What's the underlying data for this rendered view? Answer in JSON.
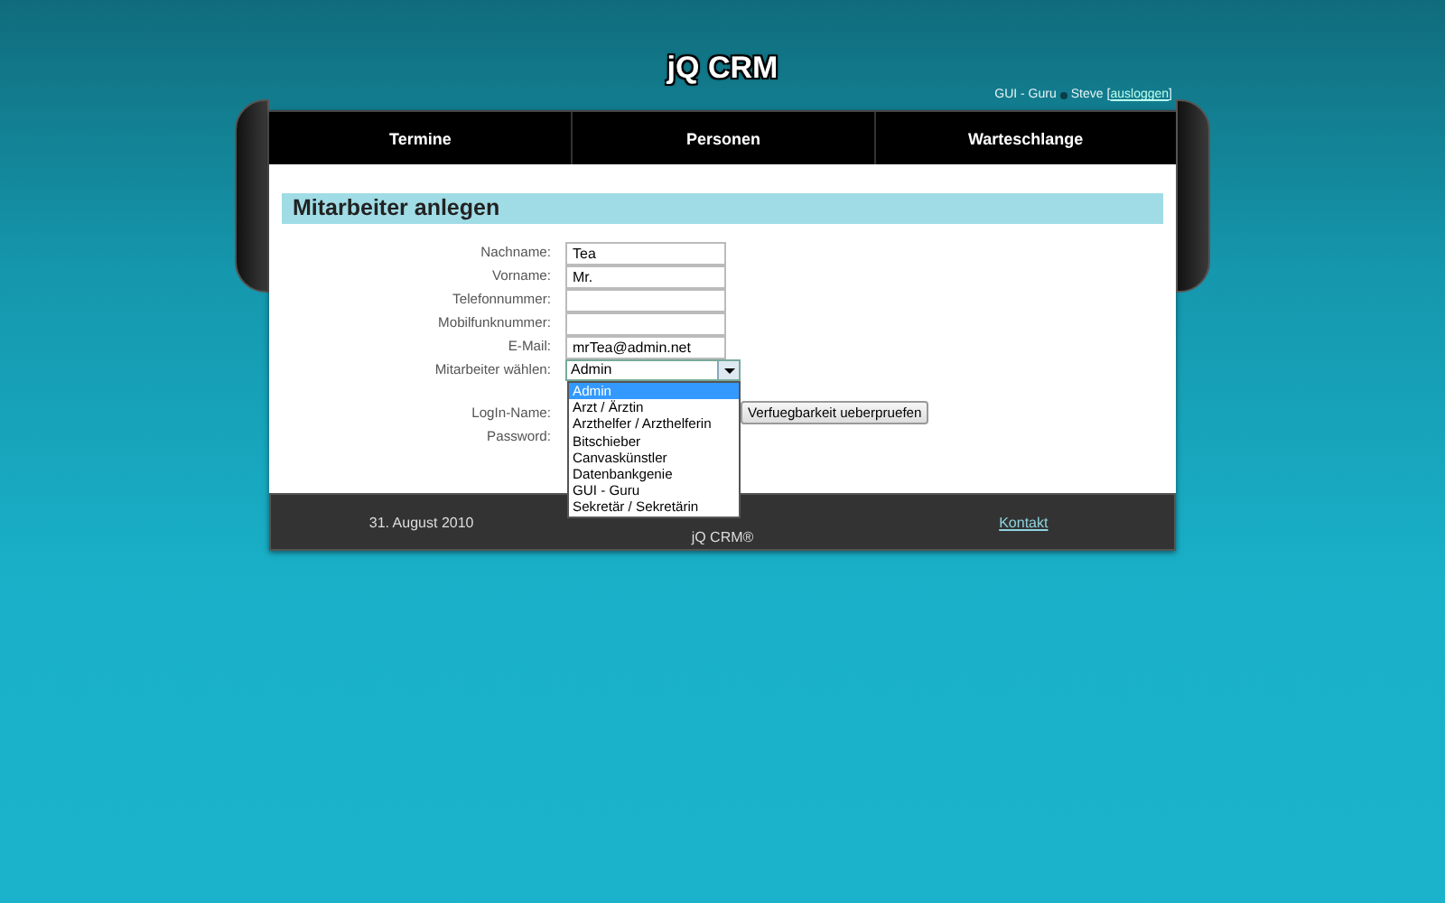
{
  "header": {
    "title": "jQ CRM",
    "user_role": "GUI - Guru",
    "user_name": "Steve",
    "bracket_open": "[",
    "logout_link": "ausloggen",
    "bracket_close": "]"
  },
  "nav": [
    {
      "label": "Termine"
    },
    {
      "label": "Personen"
    },
    {
      "label": "Warteschlange"
    }
  ],
  "section_title": "Mitarbeiter anlegen",
  "fields": [
    {
      "label": "Nachname:",
      "value": "Tea"
    },
    {
      "label": "Vorname:",
      "value": "Mr."
    },
    {
      "label": "Telefonnummer:"
    },
    {
      "label": "Mobilfunknummer:"
    },
    {
      "label": "E-Mail:",
      "value": "mrTea@admin.net"
    }
  ],
  "select": {
    "label": "Mitarbeiter wählen:",
    "value": "Admin",
    "expanded": true,
    "options": [
      {
        "label": "Admin",
        "selected": true
      },
      {
        "label": "Arzt / Ärztin",
        "selected": false
      },
      {
        "label": "Arzthelfer / Arzthelferin",
        "selected": false
      },
      {
        "label": "Bitschieber",
        "selected": false
      },
      {
        "label": "Canvaskünstler",
        "selected": false
      },
      {
        "label": "Datenbankgenie",
        "selected": false
      },
      {
        "label": "GUI - Guru",
        "selected": false
      },
      {
        "label": "Sekretär / Sekretärin",
        "selected": false
      }
    ]
  },
  "login": {
    "label": "LogIn-Name:",
    "button": "Verfuegbarkeit ueberpruefen"
  },
  "password": {
    "label": "Password:"
  },
  "footer": {
    "date": "31. August 2010",
    "brand": "jQ CRM®",
    "link": "Kontakt"
  }
}
